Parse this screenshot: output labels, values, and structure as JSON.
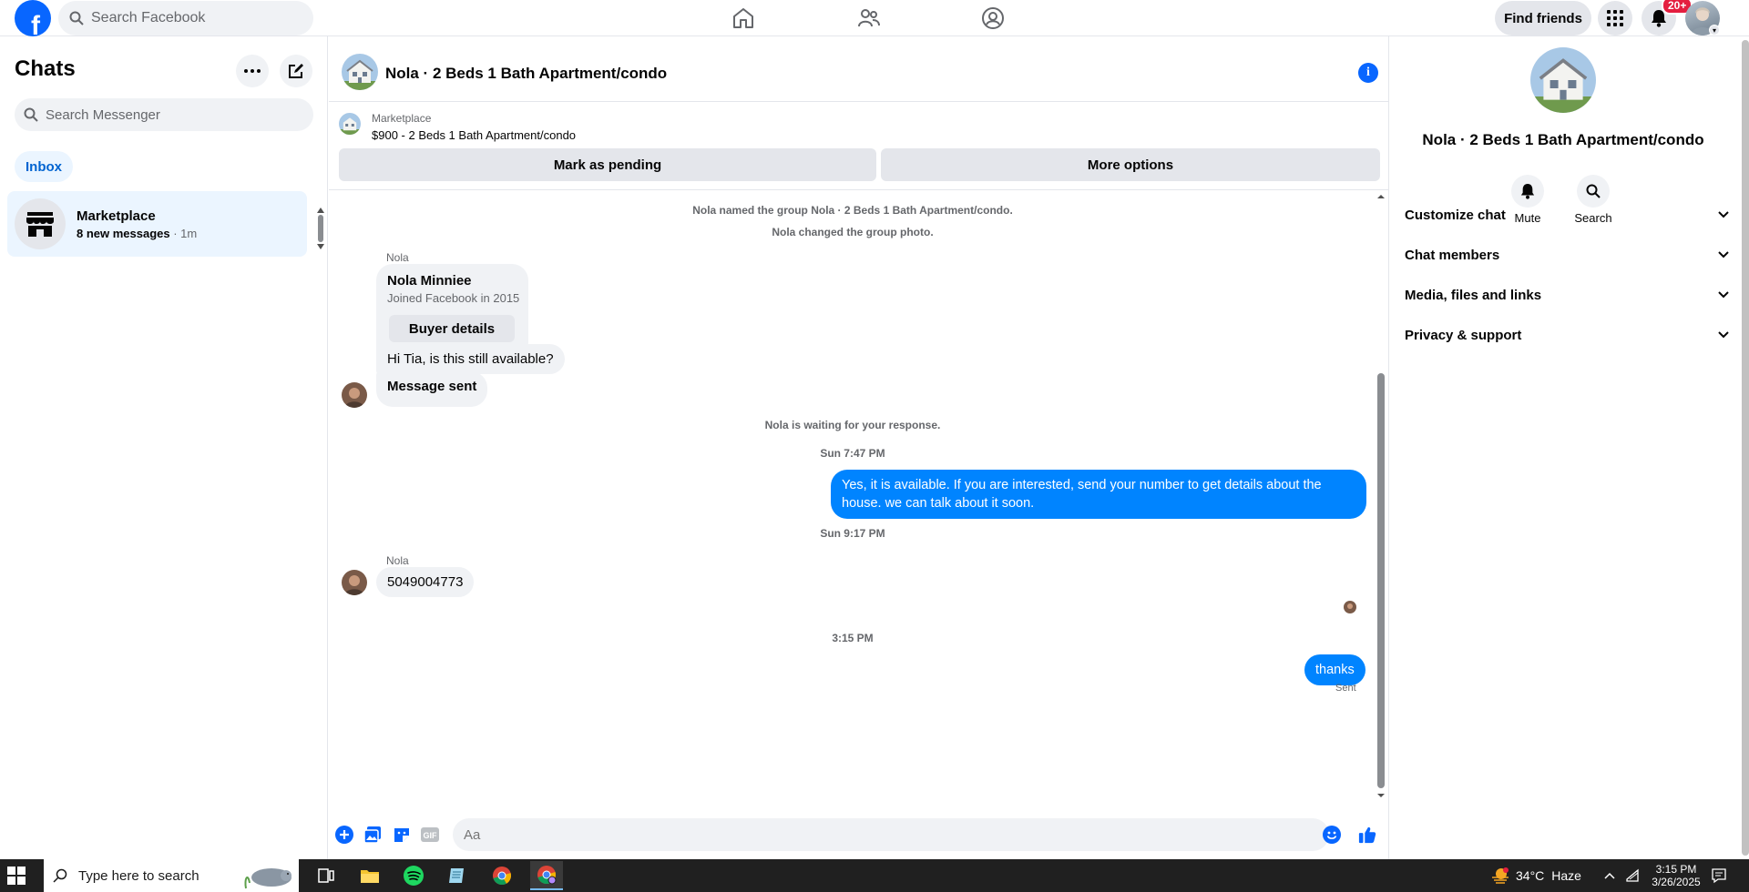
{
  "topbar": {
    "logo": "f",
    "search_placeholder": "Search Facebook",
    "find_friends": "Find friends",
    "notif_count": "20+",
    "nav_icons": [
      "home-icon",
      "friends-icon",
      "groups-icon"
    ],
    "brand_color": "#0866ff"
  },
  "sidebar": {
    "title": "Chats",
    "search_placeholder": "Search Messenger",
    "filter_chip": "Inbox",
    "conversations": [
      {
        "title": "Marketplace",
        "unread": "8 new messages",
        "time": " · 1m"
      }
    ]
  },
  "chat": {
    "title": "Nola · 2 Beds 1 Bath Apartment/condo",
    "marketplace": {
      "label": "Marketplace",
      "listing": "$900 - 2 Beds 1 Bath Apartment/condo",
      "mark_pending": "Mark as pending",
      "more_options": "More options"
    },
    "events": {
      "named_group": "Nola named the group Nola · 2 Beds 1 Bath Apartment/condo.",
      "changed_photo": "Nola changed the group photo.",
      "waiting": "Nola is waiting for your response."
    },
    "card": {
      "sender": "Nola",
      "name": "Nola Minniee",
      "joined": "Joined Facebook in 2015",
      "button": "Buyer details"
    },
    "messages": {
      "in_1": "Hi Tia, is this still available?",
      "in_2": "Message sent",
      "time_1": "Sun 7:47 PM",
      "out_1": "Yes, it is available. If you are interested, send your number to get details about the house. we can talk about it soon.",
      "time_2": "Sun 9:17 PM",
      "sender_2": "Nola",
      "in_3": "5049004773",
      "time_3": "3:15 PM",
      "out_2": "thanks",
      "status": "Sent"
    },
    "composer_placeholder": "Aa",
    "accent_color": "#0084ff"
  },
  "details": {
    "title": "Nola · 2 Beds 1 Bath Apartment/condo",
    "mute": "Mute",
    "search": "Search",
    "sections": [
      "Customize chat",
      "Chat members",
      "Media, files and links",
      "Privacy & support"
    ]
  },
  "taskbar": {
    "search_placeholder": "Type here to search",
    "weather_temp": "34°C",
    "weather_text": "Haze",
    "time": "3:15 PM",
    "date": "3/26/2025"
  }
}
